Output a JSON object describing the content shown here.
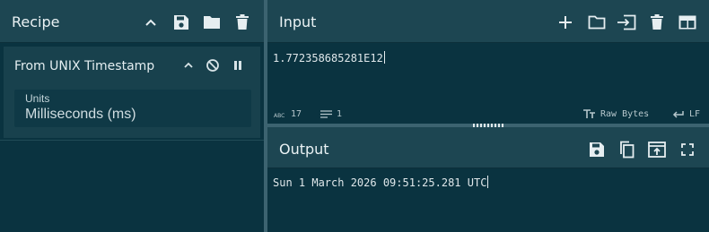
{
  "recipe": {
    "title": "Recipe",
    "buttons": [
      "chevron-up-icon",
      "save-icon",
      "folder-icon",
      "trash-icon"
    ],
    "operation": {
      "name": "From UNIX Timestamp",
      "controls": [
        "chevron-up-icon",
        "disable-icon",
        "pause-icon"
      ],
      "argument": {
        "label": "Units",
        "value": "Milliseconds (ms)"
      }
    }
  },
  "input": {
    "title": "Input",
    "buttons": [
      "plus-icon",
      "folder-icon",
      "load-icon",
      "trash-icon",
      "layout-icon"
    ],
    "text": "1.772358685281E12",
    "status": {
      "chars": "17",
      "lines": "1",
      "encoding": "Raw Bytes",
      "eol": "LF"
    }
  },
  "output": {
    "title": "Output",
    "buttons": [
      "save-icon",
      "copy-icon",
      "replace-input-icon",
      "maximize-icon"
    ],
    "text": "Sun 1 March 2026 09:51:25.281 UTC"
  },
  "colors": {
    "background": "#0a3340",
    "header": "#1d4652",
    "splitter": "#3c6370",
    "text": "#dfe9ec"
  }
}
